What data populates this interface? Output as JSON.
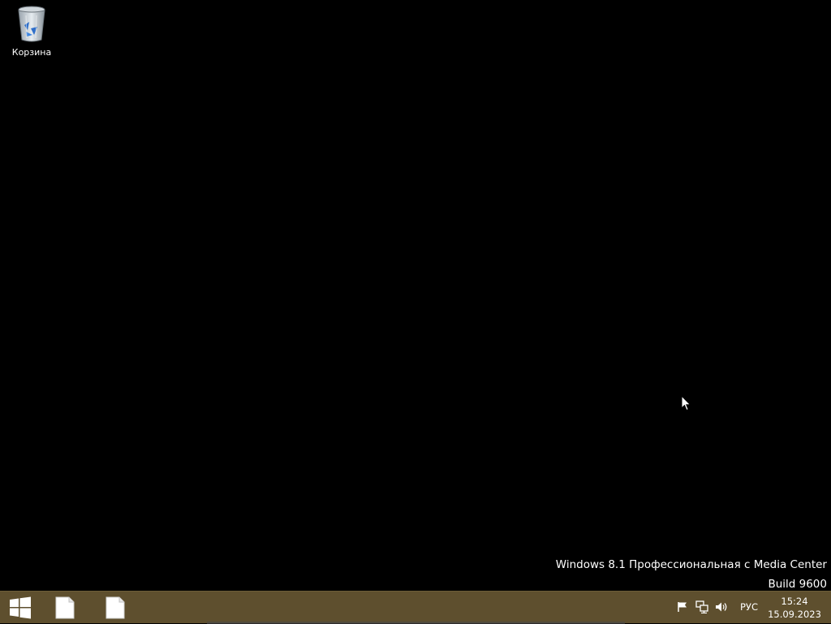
{
  "desktop": {
    "icons": [
      {
        "label": "Корзина",
        "icon": "recycle-bin-icon"
      }
    ],
    "background_color": "#000000"
  },
  "watermark": {
    "line1": "Windows 8.1 Профессиональная с Media Center",
    "line2": "Build 9600"
  },
  "taskbar": {
    "color": "#5e4f2e",
    "start_icon": "windows-logo-icon",
    "pinned": [
      {
        "icon": "document-icon"
      },
      {
        "icon": "document-icon"
      }
    ],
    "tray": {
      "icons": [
        "action-center-flag-icon",
        "network-icon",
        "volume-icon"
      ],
      "language": "РУС",
      "time": "15:24",
      "date": "15.09.2023"
    }
  }
}
